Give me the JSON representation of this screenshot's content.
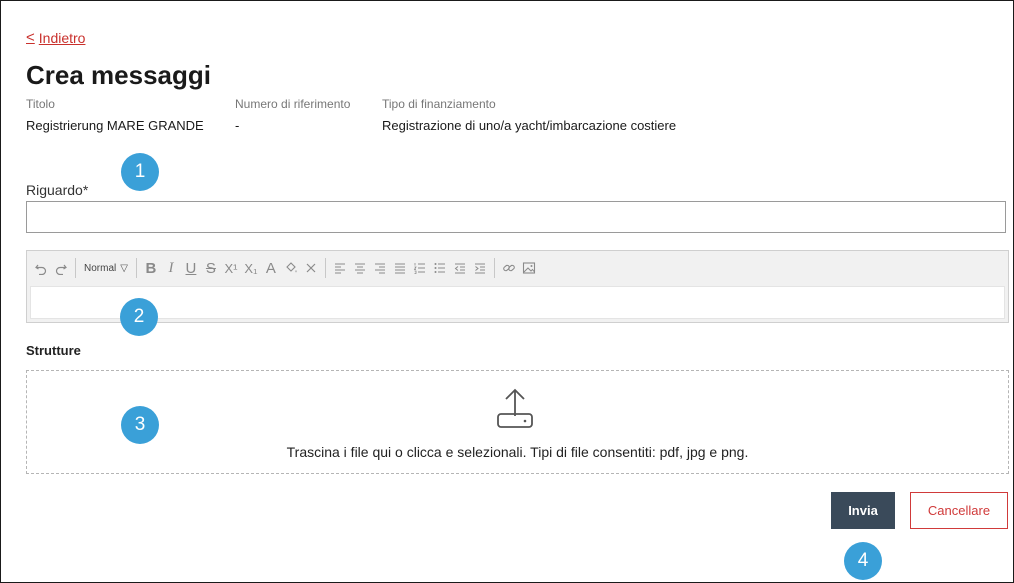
{
  "nav": {
    "back_label": "Indietro"
  },
  "page": {
    "title": "Crea messaggi"
  },
  "meta": {
    "titolo_label": "Titolo",
    "titolo_value": "Registrierung MARE GRANDE",
    "riferimento_label": "Numero di riferimento",
    "riferimento_value": "-",
    "tipo_label": "Tipo di finanziamento",
    "tipo_value": "Registrazione di uno/a yacht/imbarcazione costiere"
  },
  "form": {
    "subject_label": "Riguardo*",
    "subject_value": "",
    "format_select": "Normal",
    "attachments_title": "Strutture",
    "dropzone_text": "Trascina i file qui o clicca e selezionali. Tipi di file consentiti: pdf, jpg e png."
  },
  "actions": {
    "send_label": "Invia",
    "cancel_label": "Cancellare"
  },
  "badges": [
    "1",
    "2",
    "3",
    "4"
  ],
  "colors": {
    "accent_red": "#c9302c",
    "badge_blue": "#3aa0d8",
    "primary_button": "#3a4a5a"
  }
}
